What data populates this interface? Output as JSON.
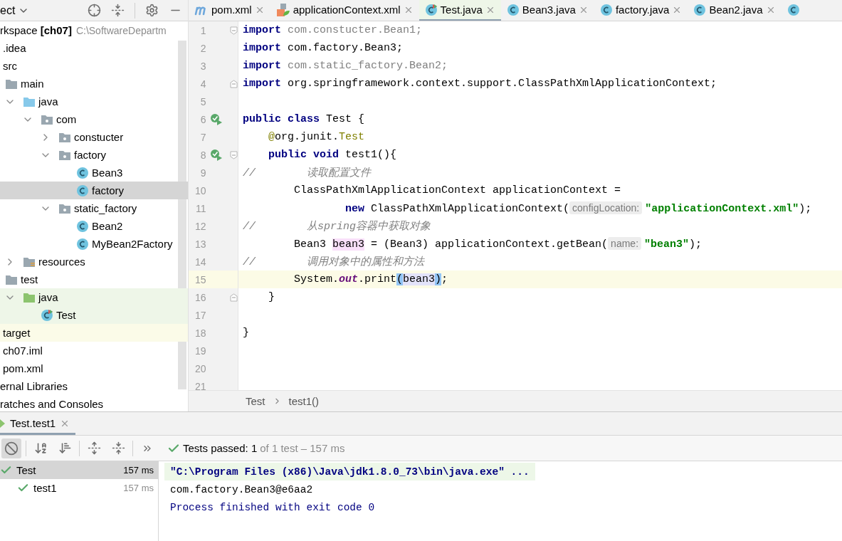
{
  "project_view": {
    "label": "ect"
  },
  "tree": [
    {
      "label": "rkspace **[ch07]**",
      "path": "C:\\SoftwareDepartm",
      "selected": false,
      "children": [
        {
          "label": ".idea",
          "selected": false
        },
        {
          "label": "src",
          "selected": false,
          "children": [
            {
              "label": "main",
              "kind": "folder",
              "selected": false,
              "children": [
                {
                  "label": "java",
                  "kind": "source",
                  "selected": false,
                  "expanded": true,
                  "children": [
                    {
                      "label": "com",
                      "kind": "package",
                      "selected": false,
                      "expanded": true,
                      "children": [
                        {
                          "label": "constucter",
                          "kind": "package",
                          "selected": false,
                          "expanded": false
                        },
                        {
                          "label": "factory",
                          "kind": "package",
                          "selected": false,
                          "expanded": true,
                          "children": [
                            {
                              "label": "Bean3",
                              "kind": "class",
                              "selected": false
                            },
                            {
                              "label": "factory",
                              "kind": "class",
                              "selected": true
                            }
                          ]
                        },
                        {
                          "label": "static_factory",
                          "kind": "package",
                          "selected": false,
                          "expanded": true,
                          "children": [
                            {
                              "label": "Bean2",
                              "kind": "class",
                              "selected": false
                            },
                            {
                              "label": "MyBean2Factory",
                              "kind": "class",
                              "selected": false
                            }
                          ]
                        }
                      ]
                    }
                  ]
                },
                {
                  "label": "resources",
                  "kind": "resources",
                  "selected": false,
                  "expanded": false
                }
              ]
            },
            {
              "label": "test",
              "kind": "folder",
              "selected": false,
              "children": [
                {
                  "label": "java",
                  "kind": "test-source",
                  "selected": false,
                  "expanded": true,
                  "test_root": true,
                  "children": [
                    {
                      "label": "Test",
                      "kind": "test-class",
                      "selected": false,
                      "test_root": true
                    }
                  ]
                }
              ]
            }
          ]
        },
        {
          "label": "target",
          "selected": false,
          "excluded": true
        },
        {
          "label": "ch07.iml",
          "selected": false
        },
        {
          "label": "pom.xml",
          "selected": false
        }
      ]
    },
    {
      "label": "ernal Libraries",
      "selected": false
    },
    {
      "label": "ratches and Consoles",
      "selected": false
    }
  ],
  "editor_tabs": [
    {
      "label": "pom.xml",
      "kind": "maven",
      "selected": false
    },
    {
      "label": "applicationContext.xml",
      "kind": "xml",
      "selected": false
    },
    {
      "label": "Test.java",
      "kind": "test-class",
      "selected": true
    },
    {
      "label": "Bean3.java",
      "kind": "class",
      "selected": false
    },
    {
      "label": "factory.java",
      "kind": "class",
      "selected": false
    },
    {
      "label": "Bean2.java",
      "kind": "class",
      "selected": false
    },
    {
      "kind": "class",
      "selected": false
    }
  ],
  "code_lines": [
    {
      "number": "1",
      "fold_start": true,
      "tokens": [
        {
          "kind": "keyword",
          "text": "import"
        },
        {
          "kind": "unused",
          "text": " com.constucter.Bean1;"
        }
      ]
    },
    {
      "number": "2",
      "tokens": [
        {
          "kind": "keyword",
          "text": "import"
        },
        {
          "kind": "plain",
          "text": " com.factory.Bean3;"
        }
      ]
    },
    {
      "number": "3",
      "tokens": [
        {
          "kind": "keyword",
          "text": "import"
        },
        {
          "kind": "unused",
          "text": " com.static_factory.Bean2;"
        }
      ]
    },
    {
      "number": "4",
      "fold_end": true,
      "tokens": [
        {
          "kind": "keyword",
          "text": "import"
        },
        {
          "kind": "plain",
          "text": " org.springframework.context.support.ClassPathXmlApplicationContext;"
        }
      ]
    },
    {
      "number": "5"
    },
    {
      "number": "6",
      "runnable": true,
      "tokens": [
        {
          "kind": "keyword",
          "text": "public class"
        },
        {
          "kind": "plain",
          "text": " Test {"
        }
      ]
    },
    {
      "number": "7",
      "tokens": [
        {
          "kind": "annotation",
          "text": "    @"
        },
        {
          "kind": "plain",
          "text": "org.junit."
        },
        {
          "kind": "annotation",
          "text": "Test"
        }
      ]
    },
    {
      "number": "8",
      "runnable": true,
      "fold_start": true,
      "tokens": [
        {
          "kind": "keyword",
          "text": "    public void"
        },
        {
          "kind": "plain",
          "text": " test1(){"
        }
      ]
    },
    {
      "number": "9",
      "tokens": [
        {
          "kind": "comment",
          "text": "//        读取配置文件"
        }
      ]
    },
    {
      "number": "10",
      "tokens": [
        {
          "kind": "plain",
          "text": "        ClassPathXmlApplicationContext applicationContext ="
        }
      ]
    },
    {
      "number": "11",
      "tokens": [
        {
          "kind": "keyword",
          "text": "                new"
        },
        {
          "kind": "plain",
          "text": " ClassPathXmlApplicationContext("
        },
        {
          "kind": "hint",
          "text": "configLocation:"
        },
        {
          "kind": "string",
          "text": "\"applicationContext.xml\""
        },
        {
          "kind": "plain",
          "text": ");"
        }
      ]
    },
    {
      "number": "12",
      "tokens": [
        {
          "kind": "comment",
          "text": "//        从spring容器中获取对象"
        }
      ]
    },
    {
      "number": "13",
      "tokens": [
        {
          "kind": "plain",
          "text": "        Bean3 "
        },
        {
          "kind": "declaration",
          "text": "bean3"
        },
        {
          "kind": "plain",
          "text": " = (Bean3) applicationContext.getBean("
        },
        {
          "kind": "hint",
          "text": "name:"
        },
        {
          "kind": "string",
          "text": "\"bean3\""
        },
        {
          "kind": "plain",
          "text": ");"
        }
      ]
    },
    {
      "number": "14",
      "tokens": [
        {
          "kind": "comment",
          "text": "//        调用对象中的属性和方法"
        }
      ]
    },
    {
      "number": "15",
      "current": true,
      "tokens": [
        {
          "kind": "plain",
          "text": "        System."
        },
        {
          "kind": "field",
          "text": "out"
        },
        {
          "kind": "plain",
          "text": ".print"
        },
        {
          "kind": "brace",
          "text": "("
        },
        {
          "kind": "usage",
          "text": "bean3"
        },
        {
          "kind": "brace",
          "text": ")"
        },
        {
          "kind": "plain",
          "text": ";"
        }
      ]
    },
    {
      "number": "16",
      "fold_end": true,
      "tokens": [
        {
          "kind": "plain",
          "text": "    }"
        }
      ]
    },
    {
      "number": "17"
    },
    {
      "number": "18",
      "tokens": [
        {
          "kind": "plain",
          "text": "}"
        }
      ]
    },
    {
      "number": "19"
    },
    {
      "number": "20"
    },
    {
      "number": "21"
    }
  ],
  "breadcrumbs": [
    "Test",
    "test1()"
  ],
  "run_tab": {
    "label": "Test.test1"
  },
  "run_status": {
    "passed": "Tests passed: 1",
    "detail": "of 1 test – 157 ms"
  },
  "test_tree": [
    {
      "label": "Test",
      "time": "157 ms",
      "selected": true,
      "children": [
        {
          "label": "test1",
          "time": "157 ms",
          "selected": false
        }
      ]
    }
  ],
  "console": [
    {
      "kind": "command",
      "text": "\"C:\\Program Files (x86)\\Java\\jdk1.8.0_73\\bin\\java.exe\" ..."
    },
    {
      "kind": "output",
      "text": "com.factory.Bean3@e6aa2"
    },
    {
      "kind": "exit",
      "text": "Process finished with exit code 0"
    }
  ]
}
